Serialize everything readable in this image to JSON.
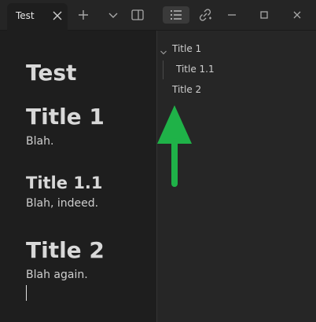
{
  "tab": {
    "label": "Test"
  },
  "editor": {
    "doc_title": "Test",
    "sections": [
      {
        "heading": "Title 1",
        "body": "Blah."
      },
      {
        "heading": "Title 1.1",
        "body": "Blah, indeed."
      },
      {
        "heading": "Title 2",
        "body": "Blah again."
      }
    ]
  },
  "outline": {
    "items": [
      {
        "label": "Title 1"
      },
      {
        "label": "Title 1.1"
      },
      {
        "label": "Title 2"
      }
    ]
  },
  "icons": {
    "close": "close-icon",
    "new_tab": "plus-icon",
    "dropdown": "chevron-down-icon",
    "split": "split-view-icon",
    "outline": "outline-list-icon",
    "link": "link-icon",
    "minimize": "minimize-icon",
    "maximize": "maximize-icon",
    "window_close": "window-close-icon"
  },
  "colors": {
    "annotation_arrow": "#1fb248",
    "editor_bg": "#1e1e1e",
    "sidebar_bg": "#262626"
  }
}
